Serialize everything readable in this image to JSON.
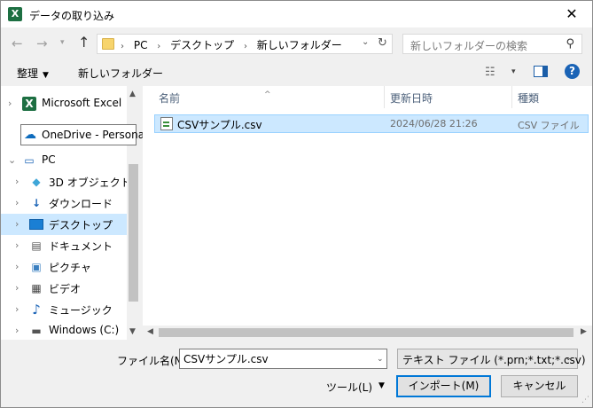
{
  "window": {
    "title": "データの取り込み",
    "app_icon_letter": "X",
    "close_glyph": "✕"
  },
  "address_bar": {
    "breadcrumb": [
      "PC",
      "デスクトップ",
      "新しいフォルダー"
    ],
    "search_placeholder": "新しいフォルダーの検索"
  },
  "toolbar": {
    "organize_label": "整理",
    "new_folder_label": "新しいフォルダー"
  },
  "nav_pane": {
    "items": [
      {
        "label": "Microsoft Excel",
        "icon": "excel-icon"
      },
      {
        "label": "PC",
        "icon": "pc-icon"
      },
      {
        "label": "3D オブジェクト",
        "icon": "3d-objects-icon"
      },
      {
        "label": "ダウンロード",
        "icon": "download-icon"
      },
      {
        "label": "デスクトップ",
        "icon": "desktop-icon",
        "selected": true
      },
      {
        "label": "ドキュメント",
        "icon": "documents-icon"
      },
      {
        "label": "ピクチャ",
        "icon": "pictures-icon"
      },
      {
        "label": "ビデオ",
        "icon": "video-icon"
      },
      {
        "label": "ミュージック",
        "icon": "music-icon"
      },
      {
        "label": "Windows (C:)",
        "icon": "drive-icon"
      }
    ],
    "tooltip_label": "OneDrive - Personal"
  },
  "file_list": {
    "columns": [
      "名前",
      "更新日時",
      "種類"
    ],
    "rows": [
      {
        "name": "CSVサンプル.csv",
        "modified": "2024/06/28 21:26",
        "type": "CSV ファイル"
      }
    ]
  },
  "footer": {
    "filename_label": "ファイル名(N):",
    "filename_value": "CSVサンプル.csv",
    "filter_label": "テキスト ファイル (*.prn;*.txt;*.csv)",
    "tools_label": "ツール(L)",
    "import_label": "インポート(M)",
    "cancel_label": "キャンセル"
  },
  "colors": {
    "selection": "#cce8ff",
    "selection_border": "#99d1ff",
    "accent": "#0078d7",
    "excel_green": "#1d6f42"
  }
}
